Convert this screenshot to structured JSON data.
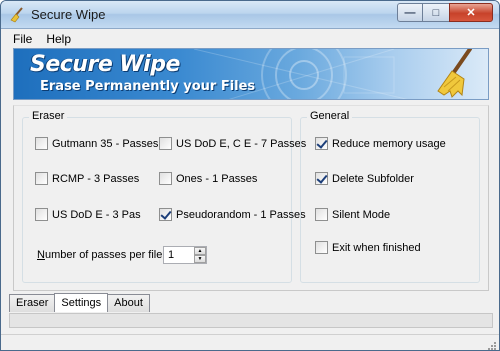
{
  "window": {
    "title": "Secure Wipe"
  },
  "menu": [
    "File",
    "Help"
  ],
  "banner": {
    "title": "Secure Wipe",
    "subtitle": "Erase Permanently your Files"
  },
  "eraser": {
    "legend": "Eraser",
    "options": [
      {
        "label": "Gutmann 35 - Passes",
        "checked": false
      },
      {
        "label": "US DoD E, C  E  - 7 Passes",
        "checked": false
      },
      {
        "label": "RCMP - 3 Passes",
        "checked": false
      },
      {
        "label": "Ones - 1 Passes",
        "checked": false
      },
      {
        "label": "US DoD E - 3 Pas",
        "checked": false
      },
      {
        "label": "Pseudorandom - 1 Passes",
        "checked": true
      }
    ],
    "passes_label_underlined": "N",
    "passes_label_rest": "umber of passes per file:",
    "passes_value": "1"
  },
  "general": {
    "legend": "General",
    "options": [
      {
        "label": "Reduce memory usage",
        "checked": true
      },
      {
        "label": "Delete Subfolder",
        "checked": true
      },
      {
        "label": "Silent Mode",
        "checked": false
      },
      {
        "label": "Exit when finished",
        "checked": false
      }
    ]
  },
  "tabs": [
    {
      "label": "Eraser",
      "active": false
    },
    {
      "label": "Settings",
      "active": true
    },
    {
      "label": "About",
      "active": false
    }
  ]
}
